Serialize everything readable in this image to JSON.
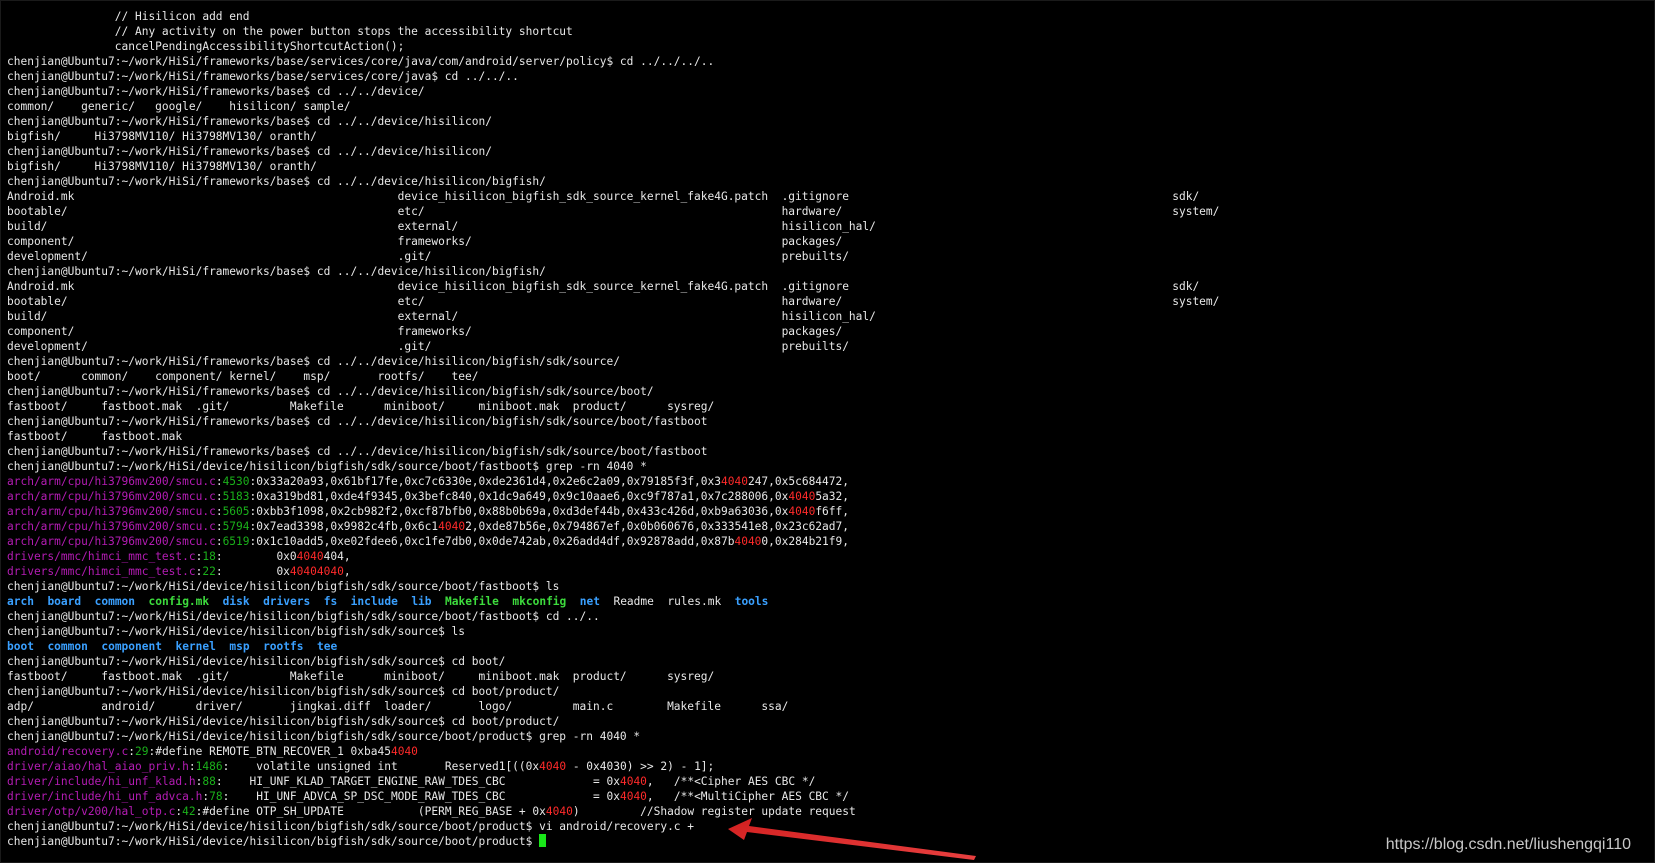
{
  "terminal": {
    "lines": [
      [
        {
          "t": "                // Hisilicon add end"
        }
      ],
      [
        {
          "t": "                // Any activity on the power button stops the accessibility shortcut"
        }
      ],
      [
        {
          "t": "                cancelPendingAccessibilityShortcutAction();"
        }
      ],
      [
        {
          "t": "chenjian@Ubuntu7:~/work/HiSi/frameworks/base/services/core/java/com/android/server/policy$ cd ../../../.."
        }
      ],
      [
        {
          "t": "chenjian@Ubuntu7:~/work/HiSi/frameworks/base/services/core/java$ cd ../../.."
        }
      ],
      [
        {
          "t": "chenjian@Ubuntu7:~/work/HiSi/frameworks/base$ cd ../../device/"
        }
      ],
      [
        {
          "t": "common/    generic/   google/    hisilicon/ sample/"
        }
      ],
      [
        {
          "t": "chenjian@Ubuntu7:~/work/HiSi/frameworks/base$ cd ../../device/hisilicon/"
        }
      ],
      [
        {
          "t": "bigfish/     Hi3798MV110/ Hi3798MV130/ oranth/"
        }
      ],
      [
        {
          "t": "chenjian@Ubuntu7:~/work/HiSi/frameworks/base$ cd ../../device/hisilicon/"
        }
      ],
      [
        {
          "t": "bigfish/     Hi3798MV110/ Hi3798MV130/ oranth/"
        }
      ],
      [
        {
          "t": "chenjian@Ubuntu7:~/work/HiSi/frameworks/base$ cd ../../device/hisilicon/bigfish/"
        }
      ],
      [
        {
          "t": "Android.mk                                                device_hisilicon_bigfish_sdk_source_kernel_fake4G.patch  .gitignore                                                sdk/"
        }
      ],
      [
        {
          "t": "bootable/                                                 etc/                                                     hardware/                                                 system/"
        }
      ],
      [
        {
          "t": "build/                                                    external/                                                hisilicon_hal/"
        }
      ],
      [
        {
          "t": "component/                                                frameworks/                                              packages/"
        }
      ],
      [
        {
          "t": "development/                                              .git/                                                    prebuilts/"
        }
      ],
      [
        {
          "t": "chenjian@Ubuntu7:~/work/HiSi/frameworks/base$ cd ../../device/hisilicon/bigfish/"
        }
      ],
      [
        {
          "t": "Android.mk                                                device_hisilicon_bigfish_sdk_source_kernel_fake4G.patch  .gitignore                                                sdk/"
        }
      ],
      [
        {
          "t": "bootable/                                                 etc/                                                     hardware/                                                 system/"
        }
      ],
      [
        {
          "t": "build/                                                    external/                                                hisilicon_hal/"
        }
      ],
      [
        {
          "t": "component/                                                frameworks/                                              packages/"
        }
      ],
      [
        {
          "t": "development/                                              .git/                                                    prebuilts/"
        }
      ],
      [
        {
          "t": "chenjian@Ubuntu7:~/work/HiSi/frameworks/base$ cd ../../device/hisilicon/bigfish/sdk/source/"
        }
      ],
      [
        {
          "t": "boot/      common/    component/ kernel/    msp/       rootfs/    tee/"
        }
      ],
      [
        {
          "t": "chenjian@Ubuntu7:~/work/HiSi/frameworks/base$ cd ../../device/hisilicon/bigfish/sdk/source/boot/"
        }
      ],
      [
        {
          "t": "fastboot/     fastboot.mak  .git/         Makefile      miniboot/     miniboot.mak  product/      sysreg/"
        }
      ],
      [
        {
          "t": "chenjian@Ubuntu7:~/work/HiSi/frameworks/base$ cd ../../device/hisilicon/bigfish/sdk/source/boot/fastboot"
        }
      ],
      [
        {
          "t": "fastboot/     fastboot.mak"
        }
      ],
      [
        {
          "t": "chenjian@Ubuntu7:~/work/HiSi/frameworks/base$ cd ../../device/hisilicon/bigfish/sdk/source/boot/fastboot"
        }
      ],
      [
        {
          "t": "chenjian@Ubuntu7:~/work/HiSi/device/hisilicon/bigfish/sdk/source/boot/fastboot$ grep -rn 4040 *"
        }
      ],
      [
        {
          "t": "arch/arm/cpu/hi3796mv200/smcu.c",
          "c": "m"
        },
        {
          "t": ":"
        },
        {
          "t": "4530",
          "c": "g"
        },
        {
          "t": ":0x33a20a93,0x61bf17fe,0xc7c6330e,0xde2361d4,0x2e6c2a09,0x79185f3f,0x3"
        },
        {
          "t": "4040",
          "c": "r"
        },
        {
          "t": "247,0x5c684472,"
        }
      ],
      [
        {
          "t": "arch/arm/cpu/hi3796mv200/smcu.c",
          "c": "m"
        },
        {
          "t": ":"
        },
        {
          "t": "5183",
          "c": "g"
        },
        {
          "t": ":0xa319bd81,0xde4f9345,0x3befc840,0x1dc9a649,0x9c10aae6,0xc9f787a1,0x7c288006,0x"
        },
        {
          "t": "4040",
          "c": "r"
        },
        {
          "t": "5a32,"
        }
      ],
      [
        {
          "t": "arch/arm/cpu/hi3796mv200/smcu.c",
          "c": "m"
        },
        {
          "t": ":"
        },
        {
          "t": "5605",
          "c": "g"
        },
        {
          "t": ":0xbb3f1098,0x2cb982f2,0xcf87bfb0,0x88b0b69a,0xd3def44b,0x433c426d,0xb9a63036,0x"
        },
        {
          "t": "4040",
          "c": "r"
        },
        {
          "t": "f6ff,"
        }
      ],
      [
        {
          "t": "arch/arm/cpu/hi3796mv200/smcu.c",
          "c": "m"
        },
        {
          "t": ":"
        },
        {
          "t": "5794",
          "c": "g"
        },
        {
          "t": ":0x7ead3398,0x9982c4fb,0x6c1"
        },
        {
          "t": "4040",
          "c": "r"
        },
        {
          "t": "2,0xde87b56e,0x794867ef,0x0b060676,0x333541e8,0x23c62ad7,"
        }
      ],
      [
        {
          "t": "arch/arm/cpu/hi3796mv200/smcu.c",
          "c": "m"
        },
        {
          "t": ":"
        },
        {
          "t": "6519",
          "c": "g"
        },
        {
          "t": ":0x1c10add5,0xe02fdee6,0xc1fe7db0,0x0de742ab,0x26add4df,0x92878add,0x87b"
        },
        {
          "t": "4040",
          "c": "r"
        },
        {
          "t": "0,0x284b21f9,"
        }
      ],
      [
        {
          "t": "drivers/mmc/himci_mmc_test.c",
          "c": "m"
        },
        {
          "t": ":"
        },
        {
          "t": "18",
          "c": "g"
        },
        {
          "t": ":        0x0"
        },
        {
          "t": "4040",
          "c": "r"
        },
        {
          "t": "404,"
        }
      ],
      [
        {
          "t": "drivers/mmc/himci_mmc_test.c",
          "c": "m"
        },
        {
          "t": ":"
        },
        {
          "t": "22",
          "c": "g"
        },
        {
          "t": ":        0x"
        },
        {
          "t": "40404040",
          "c": "r"
        },
        {
          "t": ","
        }
      ],
      [
        {
          "t": "chenjian@Ubuntu7:~/work/HiSi/device/hisilicon/bigfish/sdk/source/boot/fastboot$ ls"
        }
      ],
      [
        {
          "t": "arch",
          "c": "b"
        },
        {
          "t": "  "
        },
        {
          "t": "board",
          "c": "b"
        },
        {
          "t": "  "
        },
        {
          "t": "common",
          "c": "b"
        },
        {
          "t": "  "
        },
        {
          "t": "config.mk",
          "c": "x"
        },
        {
          "t": "  "
        },
        {
          "t": "disk",
          "c": "b"
        },
        {
          "t": "  "
        },
        {
          "t": "drivers",
          "c": "b"
        },
        {
          "t": "  "
        },
        {
          "t": "fs",
          "c": "b"
        },
        {
          "t": "  "
        },
        {
          "t": "include",
          "c": "b"
        },
        {
          "t": "  "
        },
        {
          "t": "lib",
          "c": "b"
        },
        {
          "t": "  "
        },
        {
          "t": "Makefile",
          "c": "x"
        },
        {
          "t": "  "
        },
        {
          "t": "mkconfig",
          "c": "x"
        },
        {
          "t": "  "
        },
        {
          "t": "net",
          "c": "b"
        },
        {
          "t": "  Readme  rules.mk  "
        },
        {
          "t": "tools",
          "c": "b"
        }
      ],
      [
        {
          "t": "chenjian@Ubuntu7:~/work/HiSi/device/hisilicon/bigfish/sdk/source/boot/fastboot$ cd ../.."
        }
      ],
      [
        {
          "t": "chenjian@Ubuntu7:~/work/HiSi/device/hisilicon/bigfish/sdk/source$ ls"
        }
      ],
      [
        {
          "t": "boot",
          "c": "b"
        },
        {
          "t": "  "
        },
        {
          "t": "common",
          "c": "b"
        },
        {
          "t": "  "
        },
        {
          "t": "component",
          "c": "b"
        },
        {
          "t": "  "
        },
        {
          "t": "kernel",
          "c": "b"
        },
        {
          "t": "  "
        },
        {
          "t": "msp",
          "c": "b"
        },
        {
          "t": "  "
        },
        {
          "t": "rootfs",
          "c": "b"
        },
        {
          "t": "  "
        },
        {
          "t": "tee",
          "c": "b"
        }
      ],
      [
        {
          "t": "chenjian@Ubuntu7:~/work/HiSi/device/hisilicon/bigfish/sdk/source$ cd boot/"
        }
      ],
      [
        {
          "t": "fastboot/     fastboot.mak  .git/         Makefile      miniboot/     miniboot.mak  product/      sysreg/"
        }
      ],
      [
        {
          "t": "chenjian@Ubuntu7:~/work/HiSi/device/hisilicon/bigfish/sdk/source$ cd boot/product/"
        }
      ],
      [
        {
          "t": "adp/          android/      driver/       jingkai.diff  loader/       logo/         main.c        Makefile      ssa/"
        }
      ],
      [
        {
          "t": "chenjian@Ubuntu7:~/work/HiSi/device/hisilicon/bigfish/sdk/source$ cd boot/product/"
        }
      ],
      [
        {
          "t": "chenjian@Ubuntu7:~/work/HiSi/device/hisilicon/bigfish/sdk/source/boot/product$ grep -rn 4040 *"
        }
      ],
      [
        {
          "t": "android/recovery.c",
          "c": "m"
        },
        {
          "t": ":"
        },
        {
          "t": "29",
          "c": "g"
        },
        {
          "t": ":#define REMOTE_BTN_RECOVER_1 0xba45"
        },
        {
          "t": "4040",
          "c": "r"
        }
      ],
      [
        {
          "t": "driver/aiao/hal_aiao_priv.h",
          "c": "m"
        },
        {
          "t": ":"
        },
        {
          "t": "1486",
          "c": "g"
        },
        {
          "t": ":    volatile unsigned int       Reserved1[((0x"
        },
        {
          "t": "4040",
          "c": "r"
        },
        {
          "t": " - 0x4030) >> 2) - 1];"
        }
      ],
      [
        {
          "t": "driver/include/hi_unf_klad.h",
          "c": "m"
        },
        {
          "t": ":"
        },
        {
          "t": "88",
          "c": "g"
        },
        {
          "t": ":    HI_UNF_KLAD_TARGET_ENGINE_RAW_TDES_CBC             = 0x"
        },
        {
          "t": "4040",
          "c": "r"
        },
        {
          "t": ",   /**<Cipher AES CBC */"
        }
      ],
      [
        {
          "t": "driver/include/hi_unf_advca.h",
          "c": "m"
        },
        {
          "t": ":"
        },
        {
          "t": "78",
          "c": "g"
        },
        {
          "t": ":    HI_UNF_ADVCA_SP_DSC_MODE_RAW_TDES_CBC             = 0x"
        },
        {
          "t": "4040",
          "c": "r"
        },
        {
          "t": ",   /**<MultiCipher AES CBC */"
        }
      ],
      [
        {
          "t": "driver/otp/v200/hal_otp.c",
          "c": "m"
        },
        {
          "t": ":"
        },
        {
          "t": "42",
          "c": "g"
        },
        {
          "t": ":#define OTP_SH_UPDATE           (PERM_REG_BASE + 0x"
        },
        {
          "t": "4040",
          "c": "r"
        },
        {
          "t": ")         //Shadow register update request"
        }
      ],
      [
        {
          "t": "chenjian@Ubuntu7:~/work/HiSi/device/hisilicon/bigfish/sdk/source/boot/product$ vi android/recovery.c +"
        }
      ],
      [
        {
          "t": "chenjian@Ubuntu7:~/work/HiSi/device/hisilicon/bigfish/sdk/source/boot/product$ "
        },
        {
          "cursor": true
        }
      ]
    ]
  },
  "watermark": "https://blog.csdn.net/liushengqi110",
  "colors": {
    "background": "#000000",
    "text": "#e8e8e8",
    "filename": "#b41cb4",
    "linenum": "#1ab01a",
    "match": "#ff2a2a",
    "directory": "#3aa0ff",
    "arrow": "#e3342f"
  },
  "icons": {
    "annotation": "red-arrow-icon"
  }
}
